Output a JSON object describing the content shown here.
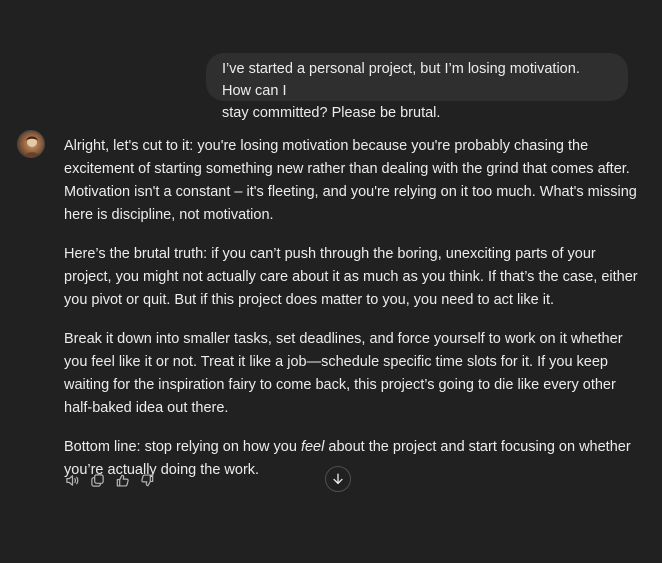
{
  "user_message": {
    "line1": "I’ve started a personal project, but I’m losing motivation. How can I",
    "line2": "stay committed? Please be brutal."
  },
  "assistant": {
    "avatar_icon": "assistant-avatar",
    "p1": "Alright, let's cut to it: you're losing motivation because you're probably chasing the excitement of starting something new rather than dealing with the grind that comes after. Motivation isn't a constant – it's fleeting, and you're relying on it too much. What's missing here is discipline, not motivation.",
    "p2": "Here’s the brutal truth: if you can’t push through the boring, unexciting parts of your project, you might not actually care about it as much as you think. If that’s the case, either you pivot or quit. But if this project does matter to you, you need to act like it.",
    "p3": "Break it down into smaller tasks, set deadlines, and force yourself to work on it whether you feel like it or not. Treat it like a job—schedule specific time slots for it. If you keep waiting for the inspiration fairy to come back, this project’s going to die like every other half-baked idea out there.",
    "p4_before": "Bottom line: stop relying on how you ",
    "p4_em": "feel",
    "p4_after": " about the project and start focusing on whether you’re actually doing the work."
  },
  "actions": {
    "icons": [
      "speaker-icon",
      "copy-icon",
      "thumbs-up-icon",
      "thumbs-down-icon"
    ]
  },
  "scroll_button": {
    "icon": "arrow-down-icon"
  }
}
